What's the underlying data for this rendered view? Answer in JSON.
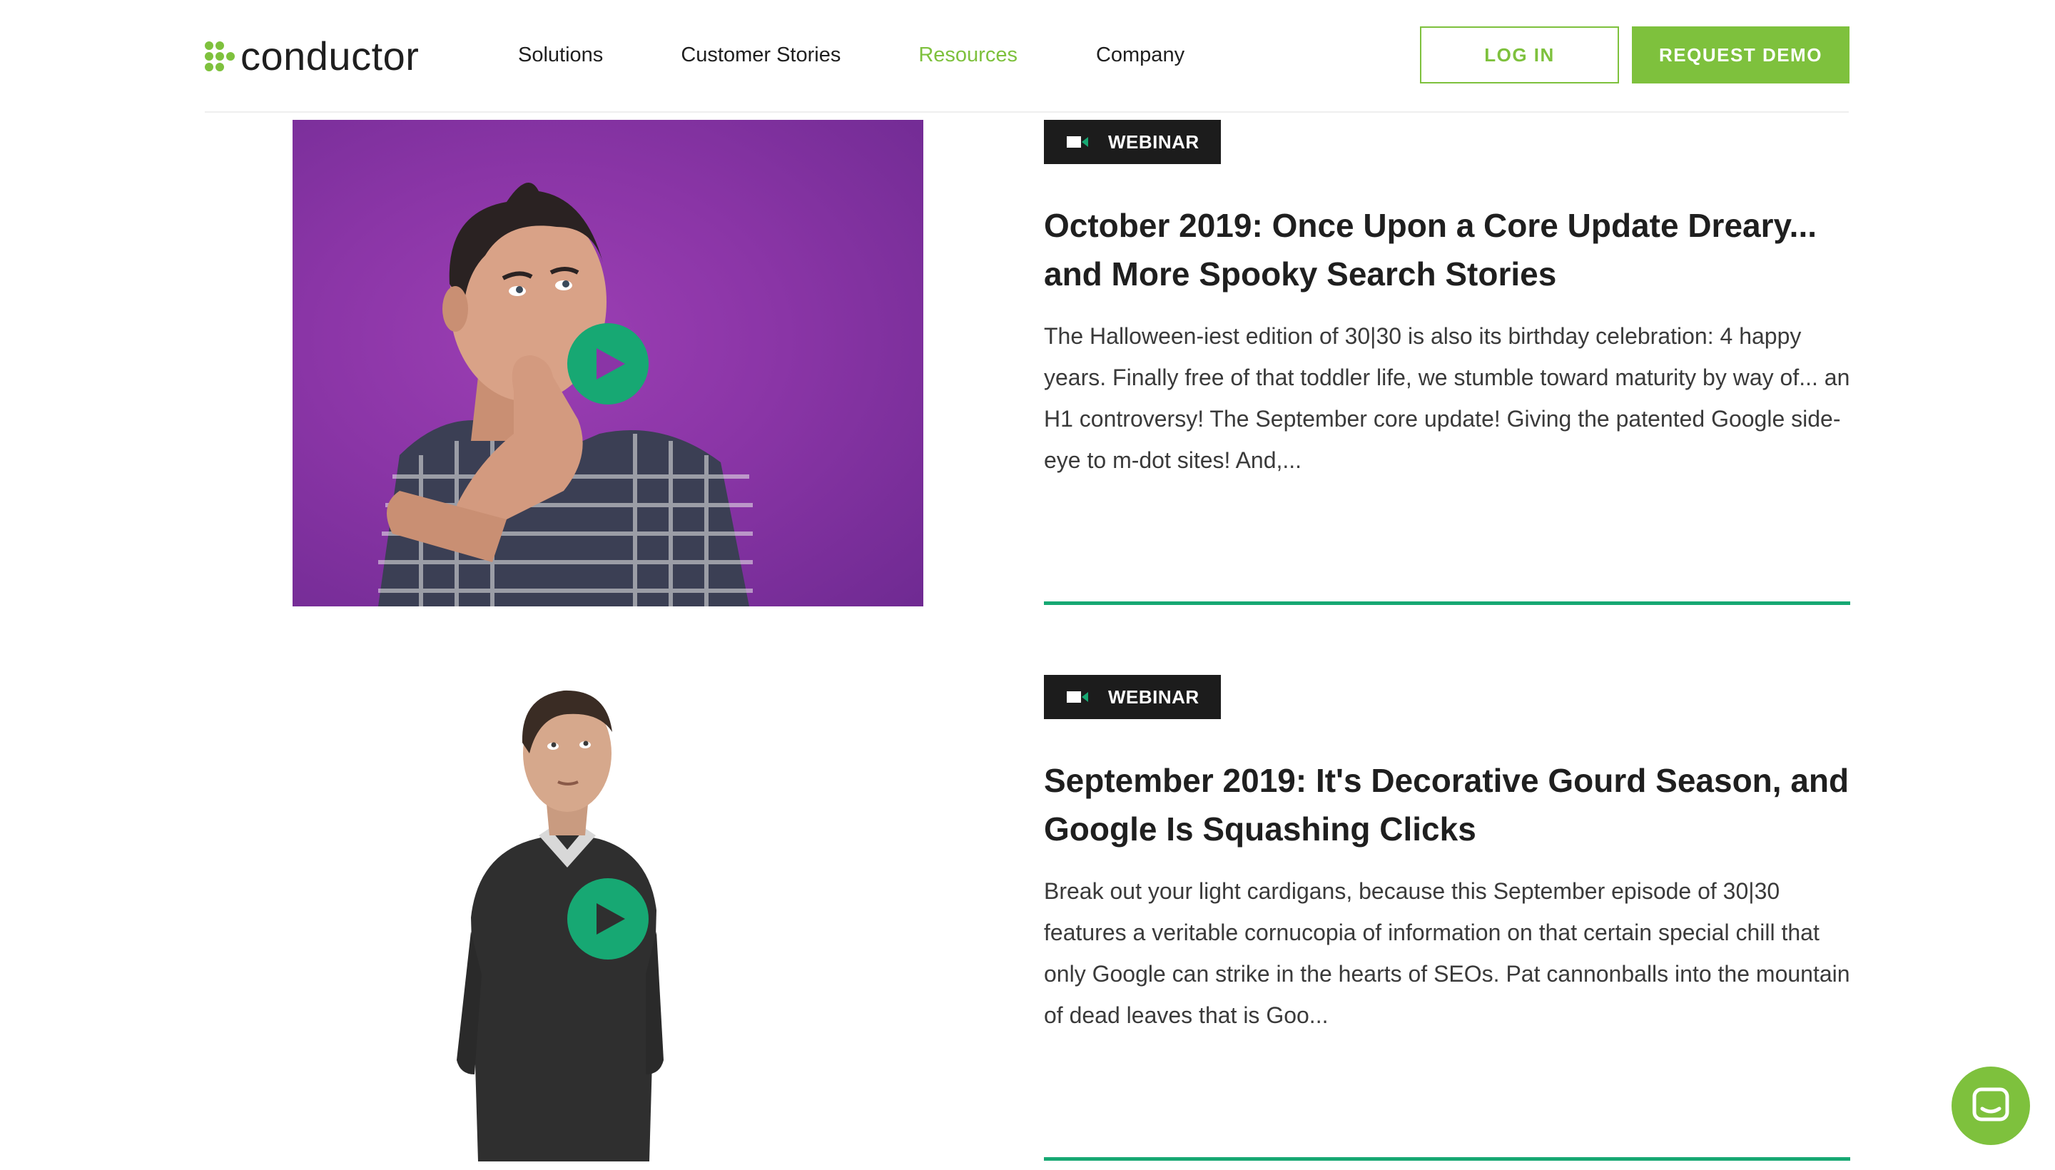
{
  "header": {
    "logo_text": "conductor",
    "nav": [
      "Solutions",
      "Customer Stories",
      "Resources",
      "Company"
    ],
    "login_label": "LOG IN",
    "demo_label": "REQUEST DEMO"
  },
  "colors": {
    "brand_green": "#7ec13d",
    "accent_teal": "#17a873",
    "badge_bg": "#1c1c1c"
  },
  "cards": [
    {
      "badge": "WEBINAR",
      "badge_icon": "video-camera-icon",
      "title": "October 2019: Once Upon a Core Update Dreary... and More Spooky Search Stories",
      "description": "The Halloween-iest edition of 30|30 is also its birthday celebration: 4 happy years. Finally free of that toddler life, we stumble toward maturity by way of... an H1 controversy! The September core update! Giving the patented Google side-eye to m-dot sites! And,...",
      "image": "man-thinking-purple-background",
      "play_icon": "play-icon"
    },
    {
      "badge": "WEBINAR",
      "badge_icon": "video-camera-icon",
      "title": "September 2019: It's Decorative Gourd Season, and Google Is Squashing Clicks",
      "description": "Break out your light cardigans, because this September episode of 30|30 features a veritable cornucopia of information on that certain special chill that only Google can strike in the hearts of SEOs. Pat cannonballs into the mountain of dead leaves that is Goo...",
      "image": "man-sweater-white-background",
      "play_icon": "play-icon"
    }
  ],
  "chat_icon": "chat-bubble-icon"
}
